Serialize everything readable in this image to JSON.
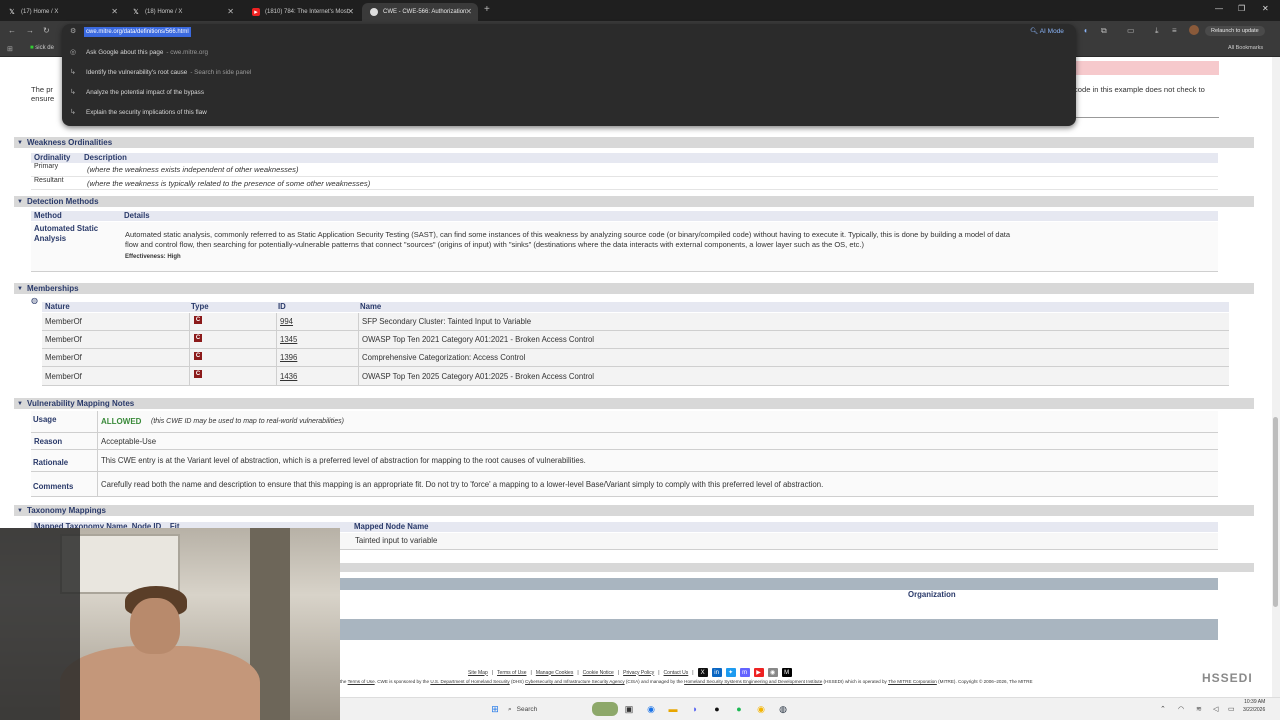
{
  "tabs": [
    {
      "label": "(17) Home / X"
    },
    {
      "label": "(18) Home / X"
    },
    {
      "label": "(1810) 784: The Internet's Most"
    },
    {
      "label": "CWE - CWE-566: Authorization"
    }
  ],
  "omnibox": {
    "url": "cwe.mitre.org/data/definitions/566.html",
    "suggestions": [
      {
        "text": "Ask Google about this page",
        "sub": "- cwe.mitre.org"
      },
      {
        "text": "Identify the vulnerability's root cause",
        "sub": "- Search in side panel"
      },
      {
        "text": "Analyze the potential impact of the bypass",
        "sub": ""
      },
      {
        "text": "Explain the security implications of this flaw",
        "sub": ""
      }
    ],
    "ai_mode": "AI Mode",
    "relaunch": "Relaunch to update"
  },
  "bookmarks": {
    "first": "sick de",
    "all": "All Bookmarks"
  },
  "intro": {
    "left": "The pr",
    "left2": "ensure",
    "right": "code in this example does not check to"
  },
  "ordinalities": {
    "title": "Weakness Ordinalities",
    "headers": [
      "Ordinality",
      "Description"
    ],
    "rows": [
      {
        "ordinality": "Primary",
        "description": "(where the weakness exists independent of other weaknesses)"
      },
      {
        "ordinality": "Resultant",
        "description": "(where the weakness is typically related to the presence of some other weaknesses)"
      }
    ]
  },
  "detection": {
    "title": "Detection Methods",
    "headers": [
      "Method",
      "Details"
    ],
    "method": "Automated Static",
    "method2": "Analysis",
    "details1": "Automated static analysis, commonly referred to as Static Application Security Testing (SAST), can find some instances of this weakness by analyzing source code (or binary/compiled code) without having to execute it. Typically, this is done by building a model of data",
    "details2": "flow and control flow, then searching for potentially-vulnerable patterns that connect \"sources\" (origins of input) with \"sinks\" (destinations where the data interacts with external components, a lower layer such as the OS, etc.)",
    "effectiveness": "Effectiveness: High"
  },
  "memberships": {
    "title": "Memberships",
    "headers": [
      "Nature",
      "Type",
      "ID",
      "Name"
    ],
    "rows": [
      {
        "nature": "MemberOf",
        "type": "C",
        "id": "994",
        "name": "SFP Secondary Cluster: Tainted Input to Variable"
      },
      {
        "nature": "MemberOf",
        "type": "C",
        "id": "1345",
        "name": "OWASP Top Ten 2021 Category A01:2021 - Broken Access Control"
      },
      {
        "nature": "MemberOf",
        "type": "C",
        "id": "1396",
        "name": "Comprehensive Categorization: Access Control"
      },
      {
        "nature": "MemberOf",
        "type": "C",
        "id": "1436",
        "name": "OWASP Top Ten 2025 Category A01:2025 - Broken Access Control"
      }
    ]
  },
  "mapping": {
    "title": "Vulnerability Mapping Notes",
    "usage_label": "Usage",
    "usage_value": "ALLOWED",
    "usage_note": "(this CWE ID may be used to map to real-world vulnerabilities)",
    "reason_label": "Reason",
    "reason_value": "Acceptable-Use",
    "rationale_label": "Rationale",
    "rationale_value": "This CWE entry is at the Variant level of abstraction, which is a preferred level of abstraction for mapping to the root causes of vulnerabilities.",
    "comments_label": "Comments",
    "comments_value": "Carefully read both the name and description to ensure that this mapping is an appropriate fit. Do not try to 'force' a mapping to a lower-level Base/Variant simply to comply with this preferred level of abstraction."
  },
  "taxonomy": {
    "title": "Taxonomy Mappings",
    "headers_partial": "Mapped Taxonomy Name  Node ID    Fit",
    "node_header": "Mapped Node Name",
    "node_value": "Tainted input to variable",
    "org_header": "Organization"
  },
  "footer": {
    "links": [
      "Site Map",
      "Terms of Use",
      "Manage Cookies",
      "Cookie Notice",
      "Privacy Policy",
      "Contact Us"
    ],
    "line2_a": "the ",
    "line2_terms": "Terms of Use",
    "line2_b": ". CWE is sponsored by the ",
    "line2_dhs": "U.S. Department of Homeland Security",
    "line2_c": " (DHS) ",
    "line2_cisa": "Cybersecurity and Infrastructure Security Agency",
    "line2_d": " (CISA) and managed by the ",
    "line2_hsse": "Homeland Security Systems Engineering and Development Institute",
    "line2_e": " (HSSEDI) which is operated by ",
    "line2_mitre": "The MITRE Corporation",
    "line2_f": " (MITRE). Copyright © 2006–2026, The MITRE",
    "logo": "HSSEDI"
  },
  "taskbar": {
    "search": "Search",
    "time": "10:39 AM",
    "date": "3/22/2026"
  },
  "colors": {
    "accent": "#2a3a6a",
    "allowed": "#3a8a3a",
    "category": "#8b1a1a"
  }
}
